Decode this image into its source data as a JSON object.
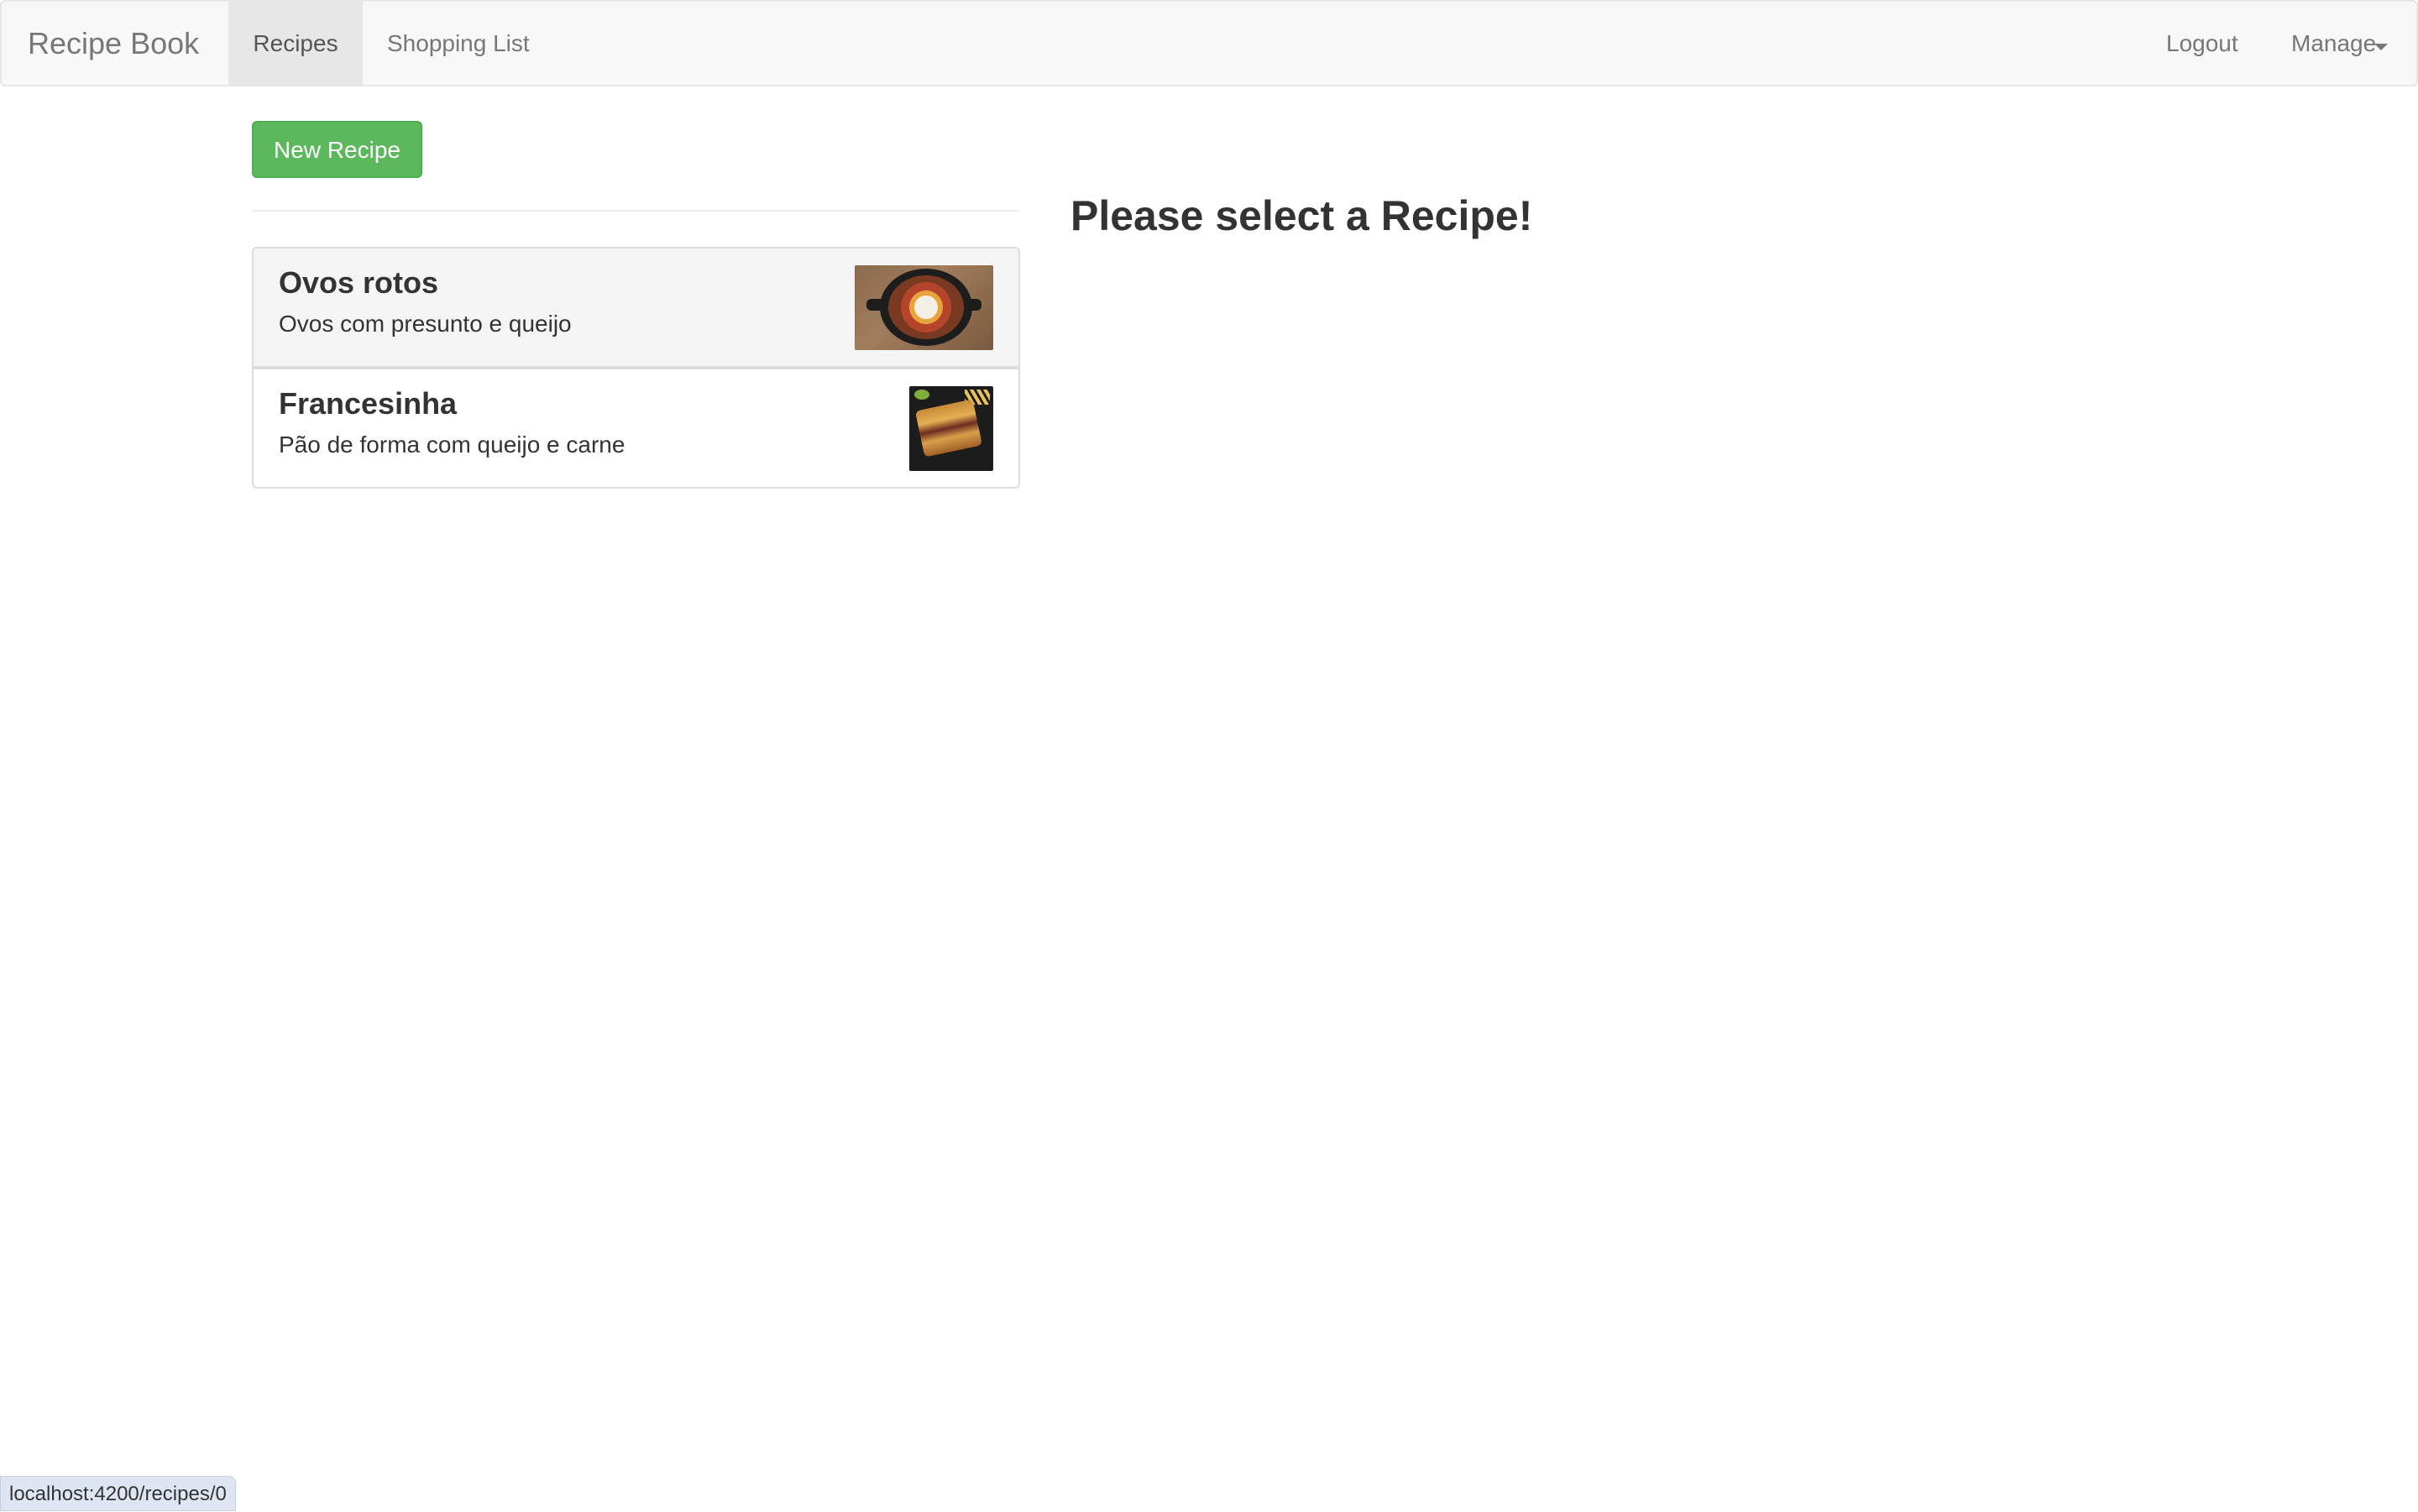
{
  "navbar": {
    "brand": "Recipe Book",
    "links": [
      {
        "label": "Recipes",
        "active": true
      },
      {
        "label": "Shopping List",
        "active": false
      }
    ],
    "right_links": {
      "logout": "Logout",
      "manage": "Manage"
    }
  },
  "recipes_panel": {
    "new_button": "New Recipe",
    "items": [
      {
        "name": "Ovos rotos",
        "description": "Ovos com presunto e queijo",
        "image": "ovos-rotos-photo",
        "highlighted": true
      },
      {
        "name": "Francesinha",
        "description": "Pão de forma com queijo e carne",
        "image": "francesinha-photo",
        "highlighted": false
      }
    ]
  },
  "detail_panel": {
    "placeholder": "Please select a Recipe!"
  },
  "status_bar": {
    "url": "localhost:4200/recipes/0"
  },
  "colors": {
    "navbar_bg": "#f8f8f8",
    "active_tab_bg": "#e7e7e7",
    "success_button": "#5cb85c",
    "text": "#333333",
    "muted_text": "#777777"
  }
}
